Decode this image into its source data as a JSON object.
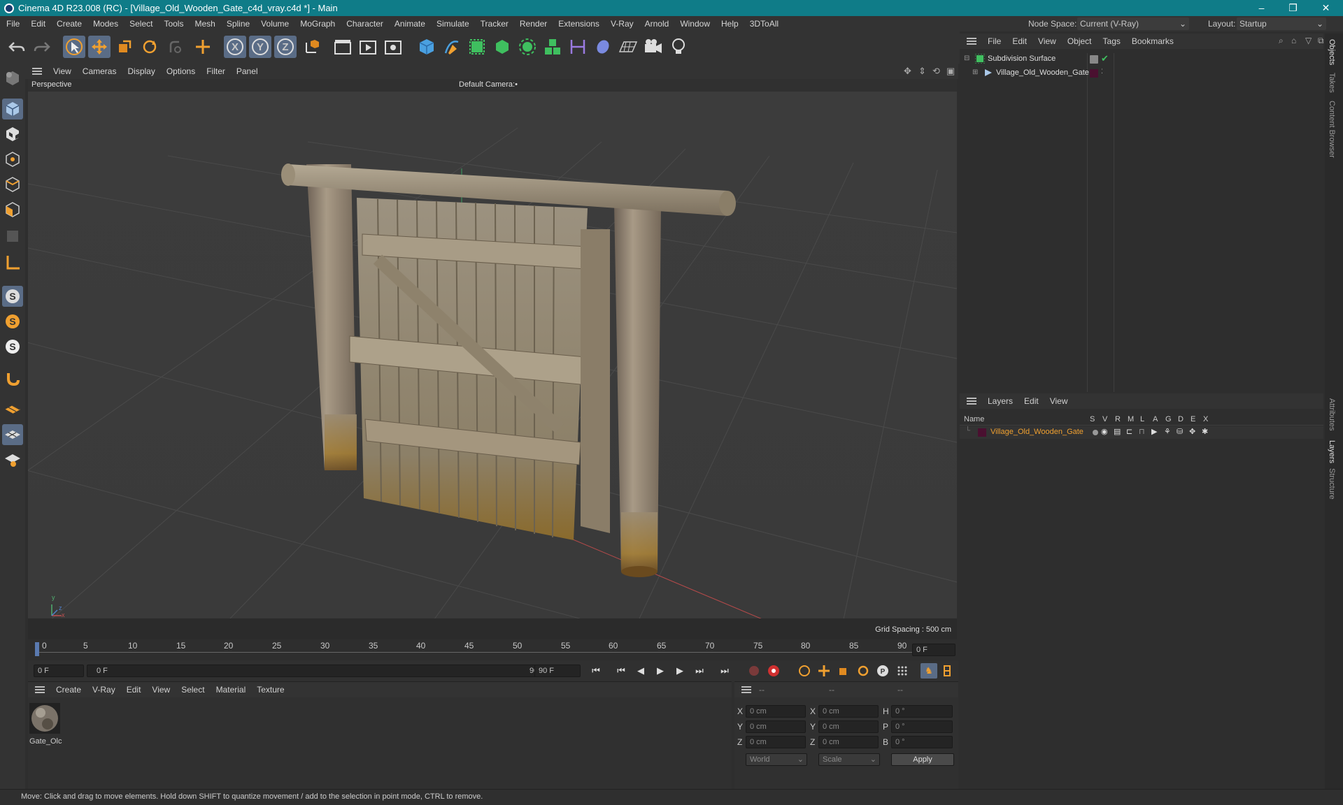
{
  "window": {
    "title": "Cinema 4D R23.008 (RC) - [Village_Old_Wooden_Gate_c4d_vray.c4d *] - Main",
    "minimize": "–",
    "restore": "❐",
    "close": "✕"
  },
  "menubar": {
    "items": [
      "File",
      "Edit",
      "Create",
      "Modes",
      "Select",
      "Tools",
      "Mesh",
      "Spline",
      "Volume",
      "MoGraph",
      "Character",
      "Animate",
      "Simulate",
      "Tracker",
      "Render",
      "Extensions",
      "V-Ray",
      "Arnold",
      "Window",
      "Help",
      "3DToAll"
    ],
    "node_space_label": "Node Space:",
    "node_space_value": "Current (V-Ray)",
    "layout_label": "Layout:",
    "layout_value": "Startup"
  },
  "toolbar": {
    "axis_x": "X",
    "axis_y": "Y",
    "axis_z": "Z"
  },
  "viewport": {
    "menu": [
      "View",
      "Cameras",
      "Display",
      "Options",
      "Filter",
      "Panel"
    ],
    "projection": "Perspective",
    "camera": "Default Camera",
    "camera_suffix": ":•",
    "grid_spacing": "Grid Spacing : 500 cm",
    "axis_y": "y",
    "axis_z": "z",
    "axis_x": "x"
  },
  "timeline": {
    "ticks": [
      "0",
      "5",
      "10",
      "15",
      "20",
      "25",
      "30",
      "35",
      "40",
      "45",
      "50",
      "55",
      "60",
      "65",
      "70",
      "75",
      "80",
      "85",
      "90"
    ],
    "current_frame": "0 F"
  },
  "playback": {
    "start_field": "0 F",
    "range_start": "0 F",
    "range_end": "90 F",
    "end_field": "90 F"
  },
  "material_panel": {
    "menu": [
      "Create",
      "V-Ray",
      "Edit",
      "View",
      "Select",
      "Material",
      "Texture"
    ],
    "material_name": "Gate_Olc"
  },
  "coords": {
    "col1_header": "--",
    "col2_header": "--",
    "col3_header": "--",
    "rows": [
      {
        "a": "X",
        "av": "0 cm",
        "b": "X",
        "bv": "0 cm",
        "c": "H",
        "cv": "0 °"
      },
      {
        "a": "Y",
        "av": "0 cm",
        "b": "Y",
        "bv": "0 cm",
        "c": "P",
        "cv": "0 °"
      },
      {
        "a": "Z",
        "av": "0 cm",
        "b": "Z",
        "bv": "0 cm",
        "c": "B",
        "cv": "0 °"
      }
    ],
    "space": "World",
    "mode": "Scale",
    "apply": "Apply"
  },
  "objects_panel": {
    "menu": [
      "File",
      "Edit",
      "View",
      "Object",
      "Tags",
      "Bookmarks"
    ],
    "items": [
      {
        "name": "Subdivision Surface"
      },
      {
        "name": "Village_Old_Wooden_Gate"
      }
    ]
  },
  "layers_panel": {
    "menu": [
      "Layers",
      "Edit",
      "View"
    ],
    "name_col": "Name",
    "flag_cols": [
      "S",
      "V",
      "R",
      "M",
      "L",
      "A",
      "G",
      "D",
      "E",
      "X"
    ],
    "layer_name": "Village_Old_Wooden_Gate",
    "layer_color": "#4a1030"
  },
  "right_tabs": [
    "Objects",
    "Takes",
    "Content Browser",
    "Attributes",
    "Layers",
    "Structure"
  ],
  "status": "Move: Click and drag to move elements. Hold down SHIFT to quantize movement / add to the selection in point mode, CTRL to remove."
}
